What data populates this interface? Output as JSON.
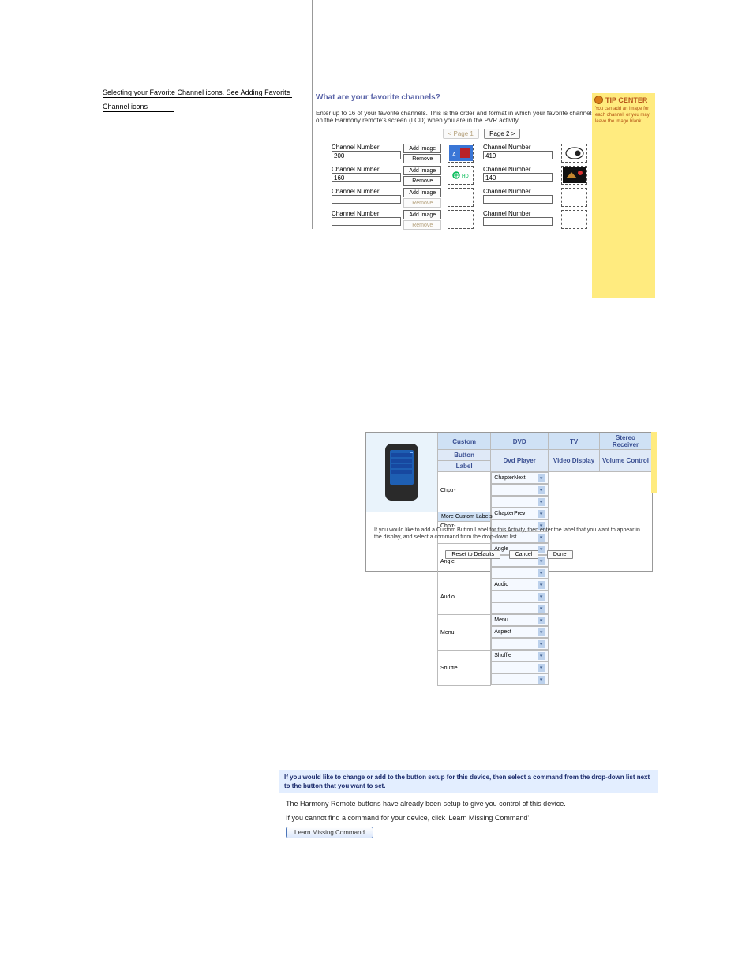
{
  "toc": {
    "l1": "Selecting your Favorite Channel icons. See Adding Favorite",
    "l2": "Channel icons"
  },
  "fav": {
    "title": "What are your favorite channels?",
    "desc": "Enter up to 16 of your favorite channels. This is the order and format in which your favorite channels will be displayed on the Harmony remote's screen (LCD) when you are in the PVR activity.",
    "page_prev": "< Page 1",
    "page_next": "Page 2 >",
    "ch_label": "Channel Number",
    "add": "Add Image",
    "rem": "Remove",
    "rows": [
      {
        "a": "200",
        "b": "419",
        "a_img": true,
        "b_img": true,
        "a_rem": true,
        "b_rem": true
      },
      {
        "a": "160",
        "b": "140",
        "a_img": true,
        "b_img": true,
        "a_rem": true,
        "b_rem": true
      },
      {
        "a": "",
        "b": "",
        "a_img": false,
        "b_img": false,
        "a_rem": false,
        "b_rem": false
      },
      {
        "a": "",
        "b": "",
        "a_img": false,
        "b_img": false,
        "a_rem": false,
        "b_rem": false
      }
    ]
  },
  "tip": {
    "title": "TIP CENTER",
    "body": "You can add an image for each channel, or you may leave the image blank."
  },
  "cfg": {
    "headers": {
      "custom": "Custom",
      "dvd": "DVD",
      "tv": "TV",
      "rec": "Stereo Receiver",
      "btn": "Button",
      "label": "Label",
      "dvdp": "Dvd Player",
      "vid": "Video Display",
      "vol": "Volume Control"
    },
    "rows": [
      {
        "lbl": "Chptr-",
        "c": "ChapterNext",
        "t": "",
        "r": ""
      },
      {
        "lbl": "Chptr-",
        "c": "ChapterPrev",
        "t": "",
        "r": ""
      },
      {
        "lbl": "Angle",
        "c": "Angle",
        "t": "",
        "r": ""
      },
      {
        "lbl": "Audio",
        "c": "Audio",
        "t": "",
        "r": ""
      },
      {
        "lbl": "Menu",
        "c": "Menu",
        "t": "Aspect",
        "r": ""
      },
      {
        "lbl": "Shuffle",
        "c": "Shuffle",
        "t": "",
        "r": ""
      }
    ],
    "more": "More Custom Labels",
    "foot": "If you would like to add a Custom Button Label for this Activity, then enter the label that you want to appear in the display, and select a command from the drop-down list.",
    "reset": "Reset to Defaults",
    "cancel": "Cancel",
    "done": "Done"
  },
  "learn": {
    "bar": "If you would like to change or add to the button setup for this device, then select a command from the drop-down list next to the button that you want to set.",
    "p1": "The Harmony Remote buttons have already been setup to give you control of this device.",
    "p2": "If you cannot find a command for your device, click 'Learn Missing Command'.",
    "btn": "Learn Missing Command"
  }
}
